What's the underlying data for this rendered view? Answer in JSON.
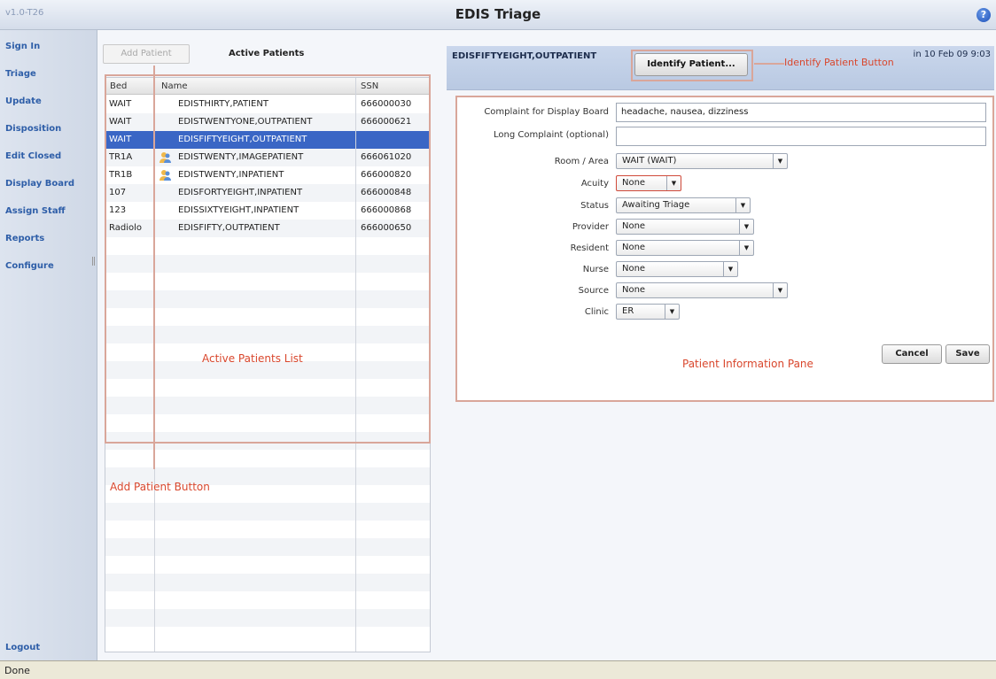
{
  "app": {
    "version": "v1.0-T26",
    "title": "EDIS Triage",
    "status": "Done"
  },
  "nav": {
    "items": [
      "Sign In",
      "Triage",
      "Update",
      "Disposition",
      "Edit Closed",
      "Display Board",
      "Assign Staff",
      "Reports",
      "Configure"
    ],
    "logout": "Logout"
  },
  "patients_panel": {
    "add_button": "Add Patient",
    "title": "Active Patients",
    "columns": [
      "Bed",
      "Name",
      "SSN"
    ],
    "rows": [
      {
        "bed": "WAIT",
        "name": "EDISTHIRTY,PATIENT",
        "ssn": "666000030",
        "icon": false
      },
      {
        "bed": "WAIT",
        "name": "EDISTWENTYONE,OUTPATIENT",
        "ssn": "666000621",
        "icon": false
      },
      {
        "bed": "WAIT",
        "name": "EDISFIFTYEIGHT,OUTPATIENT",
        "ssn": "",
        "icon": false
      },
      {
        "bed": "TR1A",
        "name": "EDISTWENTY,IMAGEPATIENT",
        "ssn": "666061020",
        "icon": true
      },
      {
        "bed": "TR1B",
        "name": "EDISTWENTY,INPATIENT",
        "ssn": "666000820",
        "icon": true
      },
      {
        "bed": "107",
        "name": "EDISFORTYEIGHT,INPATIENT",
        "ssn": "666000848",
        "icon": false
      },
      {
        "bed": "123",
        "name": "EDISSIXTYEIGHT,INPATIENT",
        "ssn": "666000868",
        "icon": false
      },
      {
        "bed": "Radiolo",
        "name": "EDISFIFTY,OUTPATIENT",
        "ssn": "666000650",
        "icon": false
      }
    ],
    "selected_row": 2
  },
  "patient_info": {
    "name": "EDISFIFTYEIGHT,OUTPATIENT",
    "date": "in 10 Feb 09 9:03",
    "identify_button": "Identify Patient...",
    "complaint_label": "Complaint for Display Board",
    "complaint_value": "headache, nausea, dizziness",
    "long_complaint_label": "Long Complaint (optional)",
    "long_complaint_value": "",
    "fields": [
      {
        "label": "Room / Area",
        "value": "WAIT  (WAIT)"
      },
      {
        "label": "Acuity",
        "value": "None"
      },
      {
        "label": "Status",
        "value": "Awaiting Triage"
      },
      {
        "label": "Provider",
        "value": "None"
      },
      {
        "label": "Resident",
        "value": "None"
      },
      {
        "label": "Nurse",
        "value": "None"
      },
      {
        "label": "Source",
        "value": "None"
      },
      {
        "label": "Clinic",
        "value": "ER"
      }
    ],
    "cancel_button": "Cancel",
    "save_button": "Save"
  },
  "annotations": {
    "identify": "Identify Patient Button",
    "active_list": "Active Patients List",
    "add_patient": "Add Patient Button",
    "info_pane": "Patient Information Pane"
  },
  "colors": {
    "nav_link": "#2e5ea8",
    "selected_row": "#3a66c5",
    "callout": "#d9472d"
  }
}
